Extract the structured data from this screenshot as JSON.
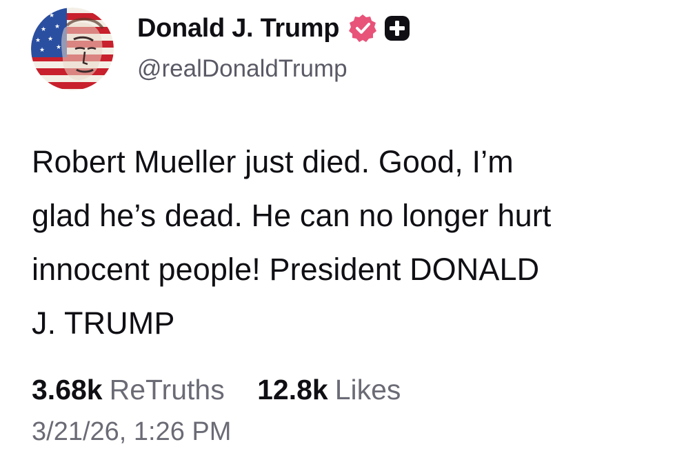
{
  "author": {
    "display_name": "Donald J. Trump",
    "handle": "@realDonaldTrump",
    "avatar_icon": "flag-portrait-avatar",
    "verified_badge_icon": "verified-badge-icon",
    "verified_badge_color": "#e8537a",
    "plus_badge_icon": "plus-badge-icon"
  },
  "post": {
    "lines": [
      "Robert Mueller just died. Good, I’m",
      "glad he’s dead. He can no longer hurt",
      "innocent people! President DONALD",
      "J. TRUMP"
    ]
  },
  "stats": {
    "retruths_count": "3.68k",
    "retruths_label": "ReTruths",
    "likes_count": "12.8k",
    "likes_label": "Likes"
  },
  "timestamp": "3/21/26, 1:26 PM"
}
